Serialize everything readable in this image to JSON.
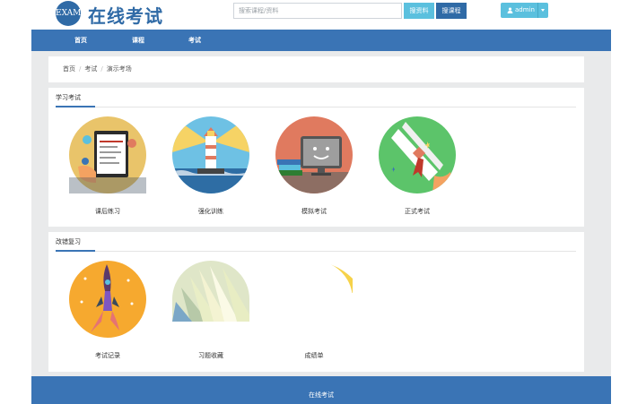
{
  "header": {
    "logo_badge": "EXAM",
    "logo_text": "在线考试",
    "search_placeholder": "搜索课程/资料",
    "search_btn1": "搜资料",
    "search_btn2": "搜课程",
    "user_label": "admin"
  },
  "nav": {
    "items": [
      "首页",
      "课程",
      "考试"
    ]
  },
  "breadcrumb": {
    "items": [
      "首页",
      "考试",
      "演示考场"
    ]
  },
  "study_section": {
    "title": "学习考试",
    "tiles": [
      {
        "label": "课后练习",
        "icon": "tablet-icon"
      },
      {
        "label": "强化训练",
        "icon": "lighthouse-icon"
      },
      {
        "label": "模拟考试",
        "icon": "monitor-icon"
      },
      {
        "label": "正式考试",
        "icon": "diploma-icon"
      }
    ]
  },
  "review_section": {
    "title": "改错复习",
    "tiles": [
      {
        "label": "考试记录",
        "icon": "rocket-icon"
      },
      {
        "label": "习题收藏",
        "icon": "book-pages-icon"
      },
      {
        "label": "成绩单",
        "icon": "graph-icon"
      }
    ]
  },
  "footer": {
    "text": "在线考试"
  },
  "colors": {
    "brand": "#2f6aa6",
    "nav": "#3a74b5",
    "info": "#5bc0de"
  }
}
